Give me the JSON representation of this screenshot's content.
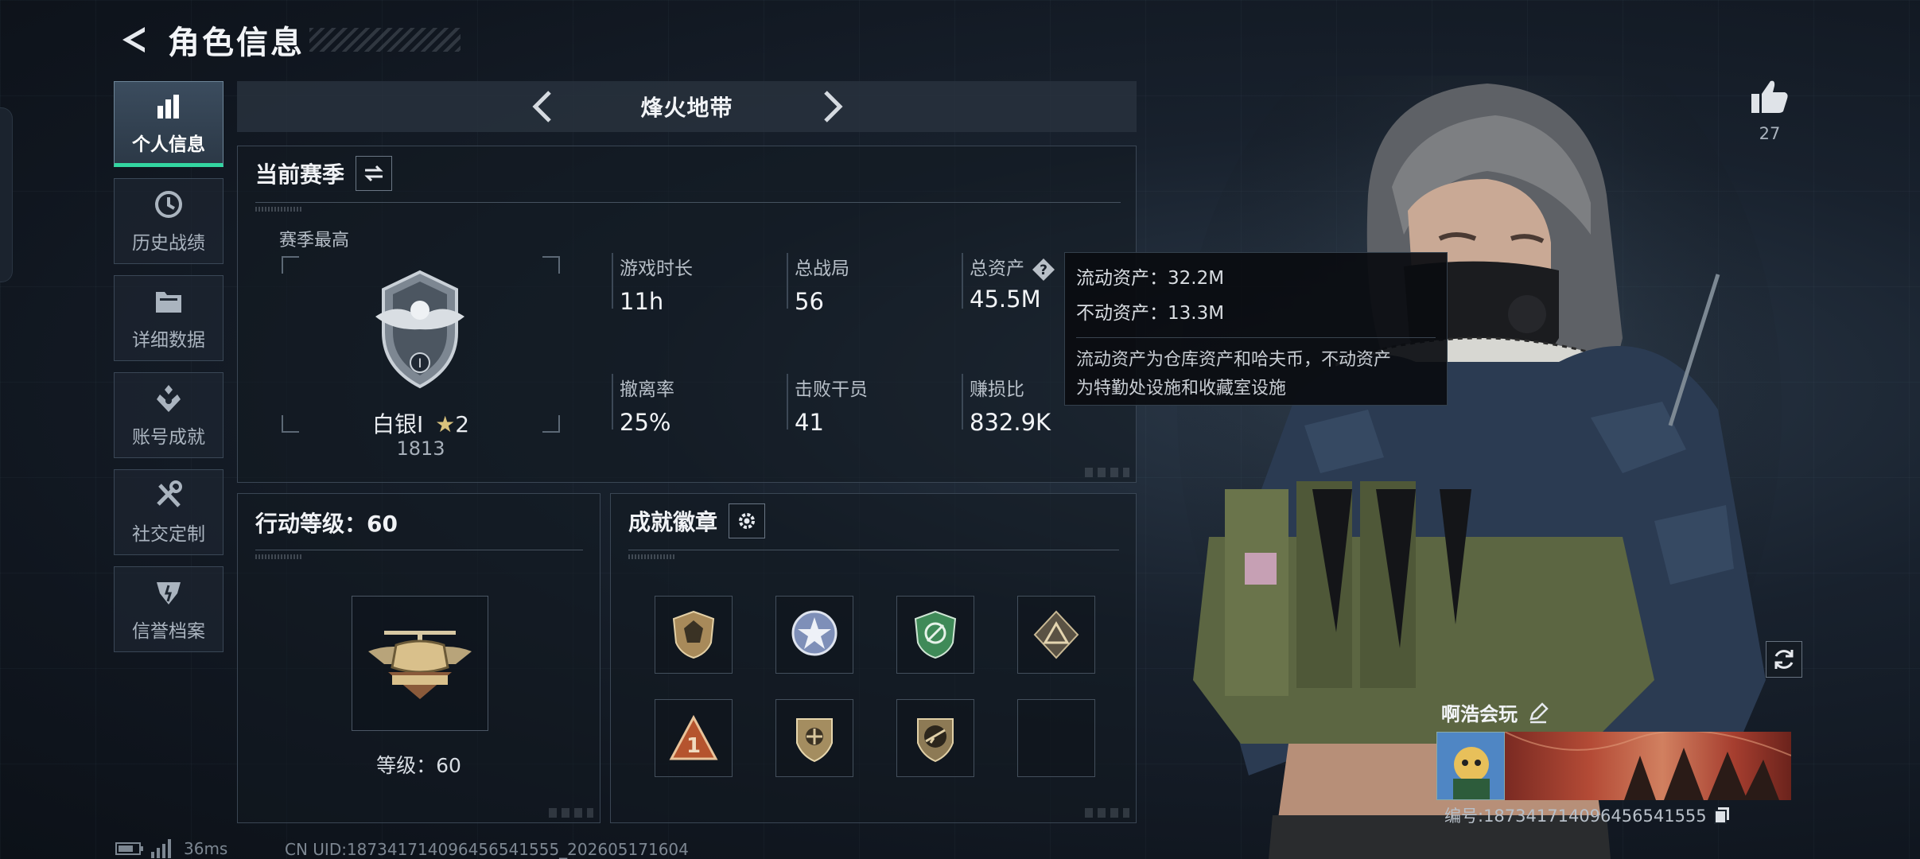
{
  "header": {
    "title": "角色信息"
  },
  "sidebar": {
    "items": [
      {
        "label": "个人信息",
        "icon": "bar-chart-icon",
        "active": true
      },
      {
        "label": "历史战绩",
        "icon": "history-icon",
        "active": false
      },
      {
        "label": "详细数据",
        "icon": "folder-icon",
        "active": false
      },
      {
        "label": "账号成就",
        "icon": "achievement-icon",
        "active": false
      },
      {
        "label": "社交定制",
        "icon": "tools-icon",
        "active": false
      },
      {
        "label": "信誉档案",
        "icon": "reputation-icon",
        "active": false
      }
    ]
  },
  "mode": {
    "title": "烽火地带"
  },
  "season": {
    "title": "当前赛季",
    "best_label": "赛季最高",
    "rank_name": "白银I",
    "rank_stars": "2",
    "rank_score": "1813",
    "stats": [
      {
        "label": "游戏时长",
        "value": "11h"
      },
      {
        "label": "总战局",
        "value": "56"
      },
      {
        "label": "总资产",
        "value": "45.5M"
      },
      {
        "label": "撤离率",
        "value": "25%"
      },
      {
        "label": "击败干员",
        "value": "41"
      },
      {
        "label": "赚损比",
        "value": "832.9K"
      }
    ]
  },
  "tooltip": {
    "liquid": "流动资产：32.2M",
    "fixed": "不动资产：13.3M",
    "desc_line1": "流动资产为仓库资产和哈夫币，不动资产",
    "desc_line2": "为特勤处设施和收藏室设施"
  },
  "level": {
    "title": "行动等级：60",
    "label": "等级：60"
  },
  "badges": {
    "title": "成就徽章",
    "slots": [
      {
        "icon": "shield-badge-icon",
        "color": "#a88a5a"
      },
      {
        "icon": "star-badge-icon",
        "color": "#7e8fb8"
      },
      {
        "icon": "green-badge-icon",
        "color": "#3f8a58"
      },
      {
        "icon": "triangle-badge-icon",
        "color": "#8a7a5c"
      },
      {
        "icon": "number-one-badge-icon",
        "color": "#b5542e"
      },
      {
        "icon": "tan-shield-badge-icon",
        "color": "#a48d60"
      },
      {
        "icon": "rifle-badge-icon",
        "color": "#8d7a55"
      },
      {
        "icon": "empty-slot",
        "color": ""
      }
    ]
  },
  "profile": {
    "likes": "27",
    "name": "啊浩会玩",
    "id": "编号:187341714096456541555"
  },
  "status": {
    "ping": "36ms",
    "uid": "CN UID:187341714096456541555_202605171604"
  },
  "colors": {
    "accent": "#33d6a1",
    "panel_border": "#3a4654"
  }
}
